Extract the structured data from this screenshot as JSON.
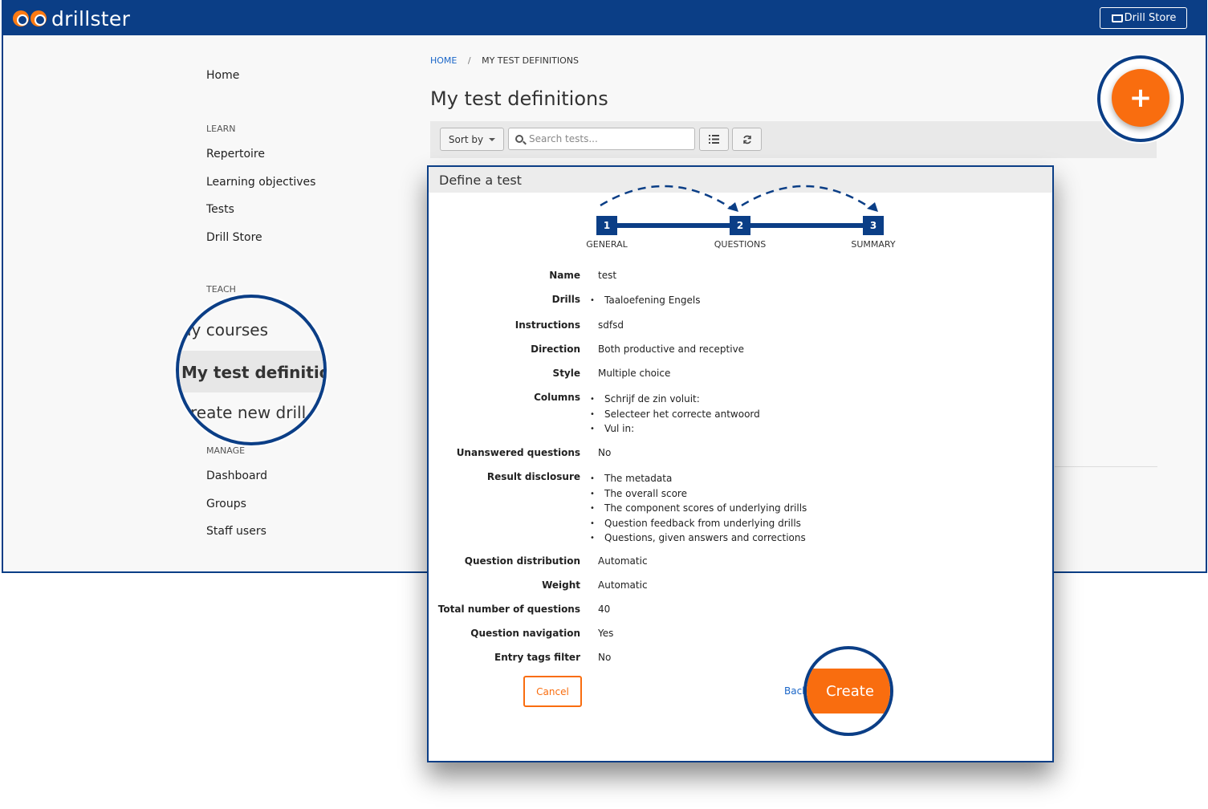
{
  "app": {
    "brand": "drillster",
    "store_button": "Drill Store"
  },
  "sidebar": {
    "home": "Home",
    "learn_heading": "LEARN",
    "learn_items": [
      "Repertoire",
      "Learning objectives",
      "Tests",
      "Drill Store"
    ],
    "teach_heading": "TEACH",
    "teach_zoom_items": [
      "My courses",
      "My test definitions",
      "Create new drill"
    ],
    "teach_zoom_visible": [
      "ly courses",
      "My test definitions",
      "reate new drill"
    ],
    "manage_heading": "MANAGE",
    "manage_items": [
      "Dashboard",
      "Groups",
      "Staff users"
    ]
  },
  "breadcrumb": {
    "home": "HOME",
    "separator": "/",
    "current": "MY TEST DEFINITIONS"
  },
  "page": {
    "title": "My test definitions"
  },
  "toolbar": {
    "sort_label": "Sort by",
    "search_placeholder": "Search tests..."
  },
  "add_button": "+",
  "modal": {
    "title": "Define a test",
    "steps": [
      {
        "number": "1",
        "label": "GENERAL"
      },
      {
        "number": "2",
        "label": "QUESTIONS"
      },
      {
        "number": "3",
        "label": "SUMMARY"
      }
    ],
    "summary": {
      "name": {
        "label": "Name",
        "value": "test"
      },
      "drills": {
        "label": "Drills",
        "items": [
          "Taaloefening Engels"
        ]
      },
      "instructions": {
        "label": "Instructions",
        "value": "sdfsd"
      },
      "direction": {
        "label": "Direction",
        "value": "Both productive and receptive"
      },
      "style": {
        "label": "Style",
        "value": "Multiple choice"
      },
      "columns": {
        "label": "Columns",
        "items": [
          "Schrijf de zin voluit:",
          "Selecteer het correcte antwoord",
          "Vul in:"
        ]
      },
      "unanswered": {
        "label": "Unanswered questions",
        "value": "No"
      },
      "disclosure": {
        "label": "Result disclosure",
        "items": [
          "The metadata",
          "The overall score",
          "The component scores of underlying drills",
          "Question feedback from underlying drills",
          "Questions, given answers and corrections"
        ]
      },
      "distribution": {
        "label": "Question distribution",
        "value": "Automatic"
      },
      "weight": {
        "label": "Weight",
        "value": "Automatic"
      },
      "total": {
        "label": "Total number of questions",
        "value": "40"
      },
      "navigation": {
        "label": "Question navigation",
        "value": "Yes"
      },
      "tags": {
        "label": "Entry tags filter",
        "value": "No"
      }
    },
    "cancel_label": "Cancel",
    "back_label": "Back",
    "create_label": "Create"
  },
  "colors": {
    "primary": "#0b3e86",
    "accent": "#f96d0f",
    "link": "#1a66c8"
  }
}
